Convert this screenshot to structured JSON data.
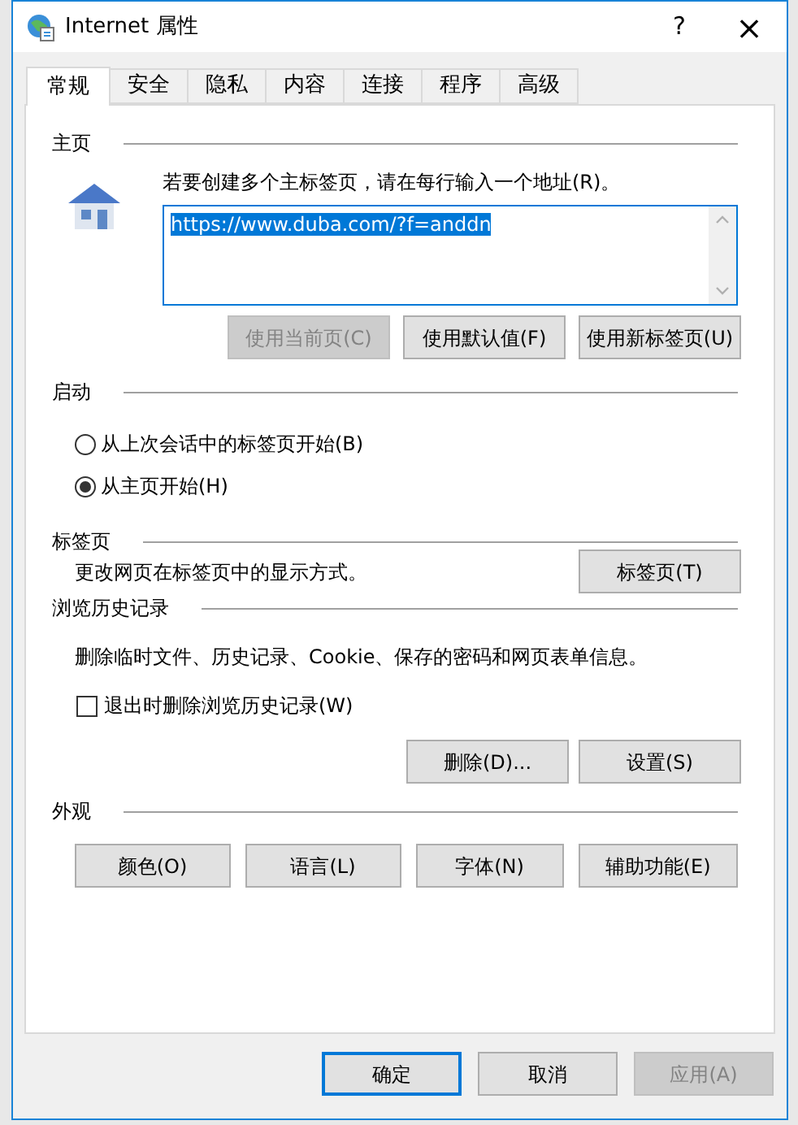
{
  "window": {
    "title": "Internet 属性",
    "help": "?",
    "close": "×"
  },
  "tabs": [
    {
      "label": "常规",
      "selected": true
    },
    {
      "label": "安全",
      "selected": false
    },
    {
      "label": "隐私",
      "selected": false
    },
    {
      "label": "内容",
      "selected": false
    },
    {
      "label": "连接",
      "selected": false
    },
    {
      "label": "程序",
      "selected": false
    },
    {
      "label": "高级",
      "selected": false
    }
  ],
  "home": {
    "heading": "主页",
    "instruction": "若要创建多个主标签页，请在每行输入一个地址(R)。",
    "value": "https://www.duba.com/?f=anddn",
    "buttons": [
      {
        "label": "使用当前页(C)",
        "disabled": true
      },
      {
        "label": "使用默认值(F)",
        "disabled": false
      },
      {
        "label": "使用新标签页(U)",
        "disabled": false
      }
    ]
  },
  "startup": {
    "heading": "启动",
    "options": [
      {
        "label": "从上次会话中的标签页开始(B)",
        "selected": false
      },
      {
        "label": "从主页开始(H)",
        "selected": true
      }
    ]
  },
  "tab_settings": {
    "heading": "标签页",
    "text": "更改网页在标签页中的显示方式。",
    "button": "标签页(T)"
  },
  "history": {
    "heading": "浏览历史记录",
    "text": "删除临时文件、历史记录、Cookie、保存的密码和网页表单信息。",
    "checkbox": {
      "label": "退出时删除浏览历史记录(W)",
      "checked": false
    },
    "buttons": [
      "删除(D)...",
      "设置(S)"
    ]
  },
  "appearance": {
    "heading": "外观",
    "buttons": [
      "颜色(O)",
      "语言(L)",
      "字体(N)",
      "辅助功能(E)"
    ]
  },
  "footer": [
    {
      "label": "确定",
      "kind": "default",
      "disabled": false
    },
    {
      "label": "取消",
      "kind": "normal",
      "disabled": false
    },
    {
      "label": "应用(A)",
      "kind": "normal",
      "disabled": true
    }
  ]
}
